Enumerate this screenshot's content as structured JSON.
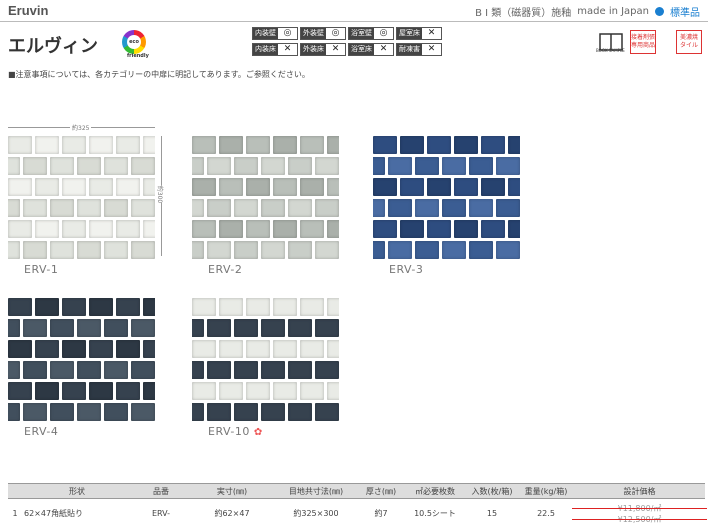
{
  "header": {
    "brand": "Eruvin",
    "classification": "B Ⅰ 類（磁器質）施釉",
    "origin": "made in Japan",
    "standard_label": "標準品"
  },
  "title": "エルヴィン",
  "eco_logo_text": "eco friendly",
  "usage": [
    {
      "label": "内装壁",
      "mark": "◎"
    },
    {
      "label": "外装壁",
      "mark": "◎"
    },
    {
      "label": "浴室壁",
      "mark": "◎"
    },
    {
      "label": "屋室床",
      "mark": "✕"
    },
    {
      "label": "内装床",
      "mark": "✕"
    },
    {
      "label": "外装床",
      "mark": "✕"
    },
    {
      "label": "浴室床",
      "mark": "✕"
    },
    {
      "label": "耐凍害",
      "mark": "✕"
    }
  ],
  "badges": {
    "book_sample": "BOOK SAMPLE",
    "adhesive": "接着剤張\n専用商品",
    "beauty": "美濃焼\nタイル"
  },
  "notice": "■注意事項については、各カテゴリーの中扉に明記してあります。ご参照ください。",
  "dimensions": {
    "width_label": "約325",
    "height_label": "約300"
  },
  "products": [
    {
      "code": "ERV-1",
      "colors": [
        "#e9ebe6",
        "#dfe2dc",
        "#f1f2ee",
        "#d8dbd4"
      ]
    },
    {
      "code": "ERV-2",
      "colors": [
        "#b9bfb9",
        "#c9cec8",
        "#aab0aa",
        "#d3d7d1"
      ]
    },
    {
      "code": "ERV-3",
      "colors": [
        "#2e4d80",
        "#3b5d93",
        "#26426f",
        "#4a6ca3"
      ]
    },
    {
      "code": "ERV-4",
      "colors": [
        "#36424f",
        "#414f5d",
        "#2d3844",
        "#4b5966"
      ]
    },
    {
      "code": "ERV-10",
      "colors": [
        "#e9ebe6",
        "#b9bfb9",
        "#2e4d80",
        "#36424f",
        "#c9cec8",
        "#3b5d93"
      ]
    }
  ],
  "new_mark": "✿",
  "table": {
    "headers": [
      "",
      "形状",
      "品番",
      "実寸(㎜)",
      "目地共寸法(㎜)",
      "厚さ(㎜)",
      "㎡必要枚数",
      "入数(枚/箱)",
      "重量(kg/箱)",
      "設計価格"
    ],
    "row": {
      "no": "1",
      "shape": "62×47角紙貼り",
      "code": "ERV-",
      "size": "約62×47",
      "joint": "約325×300",
      "thickness": "約7",
      "per_sqm": "10.5シート",
      "per_box": "15",
      "weight": "22.5",
      "price1": "¥11,800/㎡",
      "price2": "¥12,500/㎡"
    }
  }
}
